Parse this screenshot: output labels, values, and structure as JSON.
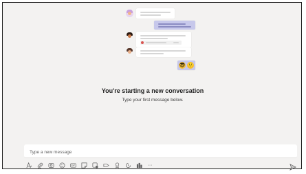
{
  "empty_state": {
    "title": "You're starting a new conversation",
    "subtitle": "Type your first message below."
  },
  "composer": {
    "placeholder": "Type a new message"
  },
  "toolbar": {
    "icons": [
      "format-icon",
      "attach-icon",
      "loop-icon",
      "emoji-icon",
      "gif-icon",
      "sticker-icon",
      "meet-now-icon",
      "send-link-icon",
      "praise-icon",
      "schedule-icon",
      "apps-icon",
      "more-options-icon"
    ],
    "more_label": "···"
  },
  "illustration": {
    "emojis": [
      "😎",
      "🙂"
    ]
  },
  "colors": {
    "accent": "#6264a7",
    "background": "#f3f2f1",
    "bubble_self": "#c7c8eb"
  }
}
